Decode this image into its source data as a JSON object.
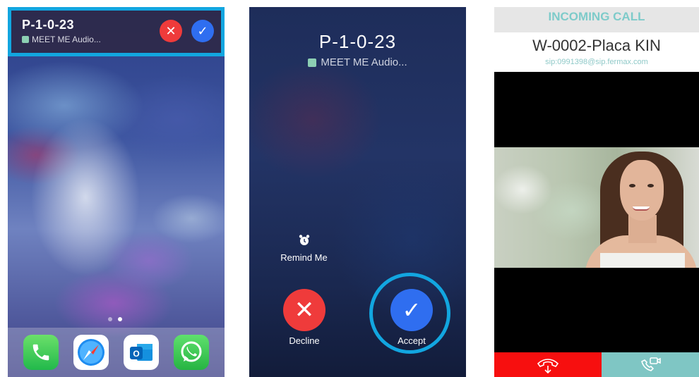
{
  "banner": {
    "caller": "P-1-0-23",
    "app_name": "MEET ME Audio...",
    "decline_icon": "x-icon",
    "accept_icon": "check-icon"
  },
  "home": {
    "dock_apps": [
      "Phone",
      "Safari",
      "Outlook",
      "WhatsApp"
    ]
  },
  "call_screen": {
    "caller": "P-1-0-23",
    "app_name": "MEET ME Audio...",
    "remind_label": "Remind Me",
    "decline_label": "Decline",
    "accept_label": "Accept"
  },
  "fermax": {
    "header": "INCOMING CALL",
    "device_name": "W-0002-Placa KIN",
    "sip_uri": "sip:0991398@sip.fermax.com",
    "colors": {
      "accent": "#7fc6c4",
      "hangup": "#f70f0f"
    }
  },
  "colors": {
    "decline": "#ef3b3b",
    "accept": "#2f6ef0",
    "highlight": "#12a6e0"
  }
}
